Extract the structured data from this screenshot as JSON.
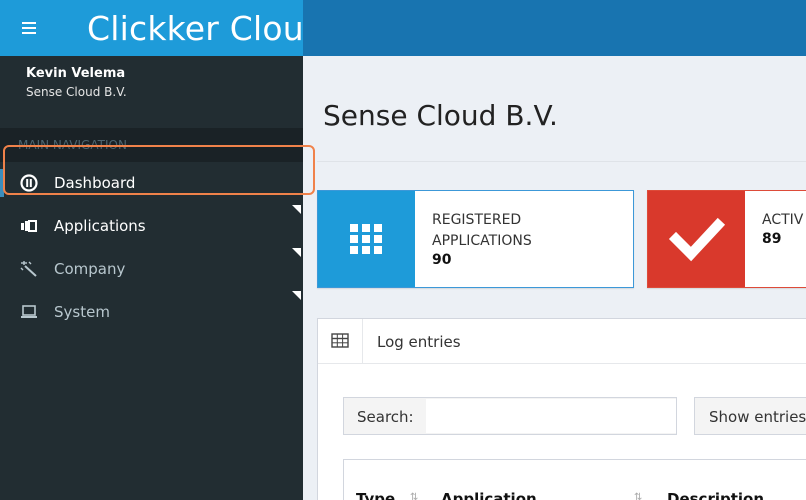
{
  "header": {
    "app_title": "Clickker Cloud",
    "menu_icon": "hamburger-icon"
  },
  "user": {
    "name": "Kevin Velema",
    "organization": "Sense Cloud B.V."
  },
  "sidebar": {
    "section_header": "MAIN NAVIGATION",
    "items": [
      {
        "label": "Dashboard",
        "icon": "dashboard-icon",
        "active": true
      },
      {
        "label": "Applications",
        "icon": "applications-icon",
        "has_children": true
      },
      {
        "label": "Company",
        "icon": "magic-wand-icon",
        "has_children": true
      },
      {
        "label": "System",
        "icon": "laptop-icon",
        "has_children": true
      }
    ]
  },
  "main": {
    "page_title": "Sense Cloud B.V.",
    "info_boxes": [
      {
        "label_line1": "REGISTERED",
        "label_line2": "APPLICATIONS",
        "value": "90",
        "icon": "grid-icon",
        "color": "#1e9bd9"
      },
      {
        "label_line1": "ACTIV",
        "value": "89",
        "icon": "check-icon",
        "color": "#d9392c"
      }
    ],
    "log": {
      "title": "Log entries",
      "search_label": "Search:",
      "search_value": "",
      "show_entries_label": "Show entries",
      "columns": [
        "Type",
        "Application",
        "Description"
      ]
    }
  },
  "colors": {
    "accent": "#1e9bd9",
    "topbar": "#1874b0",
    "sidebar_bg": "#222d32",
    "danger": "#d9392c",
    "focus_outline": "#f0824a"
  }
}
